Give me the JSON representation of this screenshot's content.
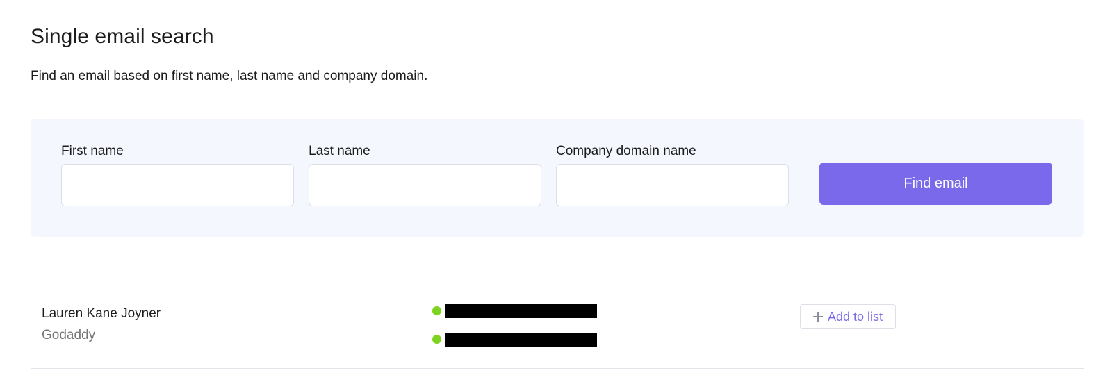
{
  "header": {
    "title": "Single email search",
    "subtitle": "Find an email based on first name, last name and company domain."
  },
  "search_form": {
    "first_name": {
      "label": "First name",
      "value": "",
      "placeholder": ""
    },
    "last_name": {
      "label": "Last name",
      "value": "",
      "placeholder": ""
    },
    "company_domain": {
      "label": "Company domain name",
      "value": "",
      "placeholder": ""
    },
    "submit_label": "Find email"
  },
  "results": [
    {
      "name": "Lauren Kane Joyner",
      "company": "Godaddy",
      "emails": [
        {
          "status": "valid",
          "status_color": "#7ed321",
          "redacted": true
        },
        {
          "status": "valid",
          "status_color": "#7ed321",
          "redacted": true
        }
      ],
      "action_label": "Add to list",
      "action_icon": "plus-icon"
    }
  ],
  "colors": {
    "accent": "#7a69ea",
    "panel_background": "#f4f7fd",
    "valid_status": "#7ed321"
  }
}
